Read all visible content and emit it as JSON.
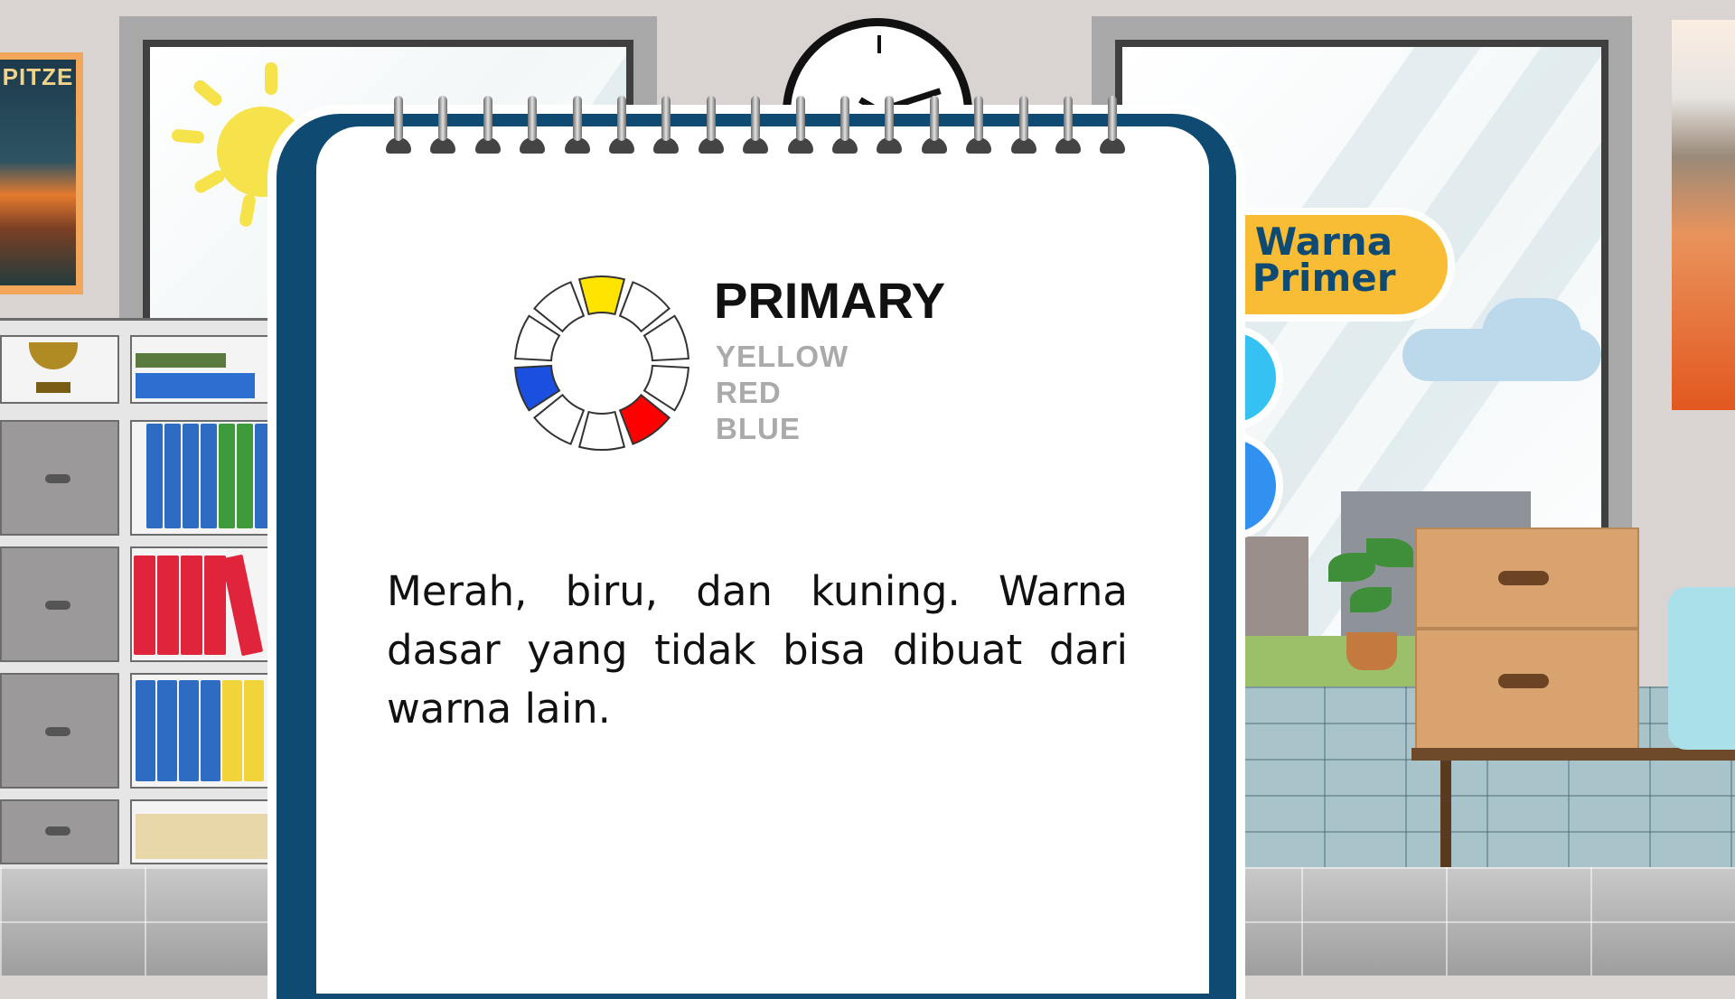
{
  "tab": {
    "label": "Warna Primer"
  },
  "card": {
    "title": "PRIMARY",
    "colors": [
      "YELLOW",
      "RED",
      "BLUE"
    ],
    "description": "Merah, biru, dan kuning. Warna dasar yang tidak bisa dibuat dari warna lain."
  },
  "poster": {
    "text": "PITZE"
  },
  "palette": {
    "tab_yellow": "#f8bd34",
    "tab_cyan": "#35c1f1",
    "tab_blue": "#3290f0",
    "notebook_navy": "#0f4a72",
    "wheel_yellow": "#ffe400",
    "wheel_red": "#ff0000",
    "wheel_blue": "#1a4fe0"
  }
}
